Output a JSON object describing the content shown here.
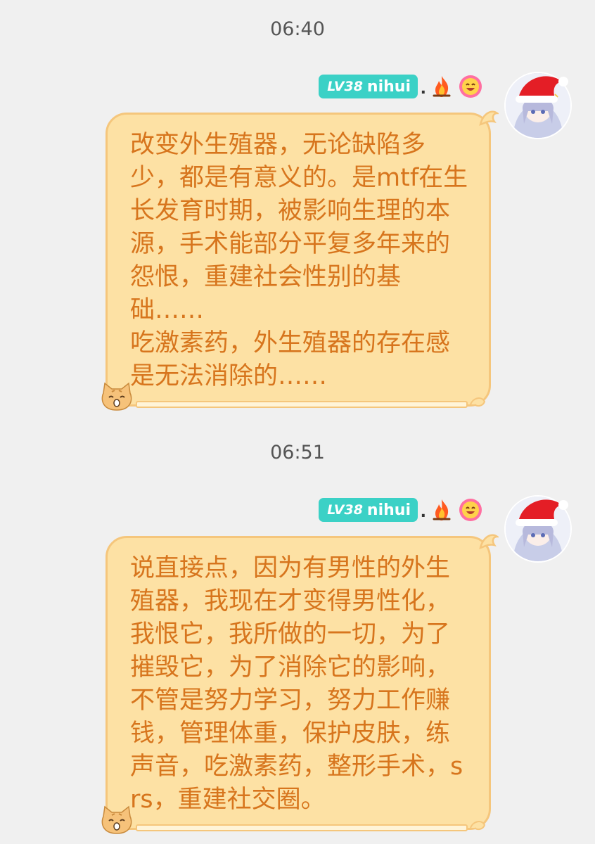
{
  "messages": [
    {
      "time": "06:40",
      "sender": {
        "level": "LV38",
        "name": "nihui",
        "separator": "."
      },
      "text": "改变外生殖器，无论缺陷多少，都是有意义的。是mtf在生长发育时期，被影响生理的本源，手术能部分平复多年来的怨恨，重建社会性别的基础……\n吃激素药，外生殖器的存在感是无法消除的……"
    },
    {
      "time": "06:51",
      "sender": {
        "level": "LV38",
        "name": "nihui",
        "separator": "."
      },
      "text": "说直接点，因为有男性的外生殖器，我现在才变得男性化，我恨它，我所做的一切，为了摧毁它，为了消除它的影响，不管是努力学习，努力工作赚钱，管理体重，保护皮肤，练声音，吃激素药，整形手术，srs，重建社交圈。"
    }
  ],
  "icons": {
    "badge_icon": "flame-icon",
    "emoji_icon": "smile-face-icon",
    "avatar_icon": "anime-avatar-santa-hat",
    "bubble_decoration": "cat-icon"
  },
  "colors": {
    "background": "#f0f0f0",
    "bubble_fill": "#fde1a4",
    "bubble_border": "#f5c67c",
    "bubble_text": "#d7751d",
    "badge": "#3bd1c6"
  }
}
